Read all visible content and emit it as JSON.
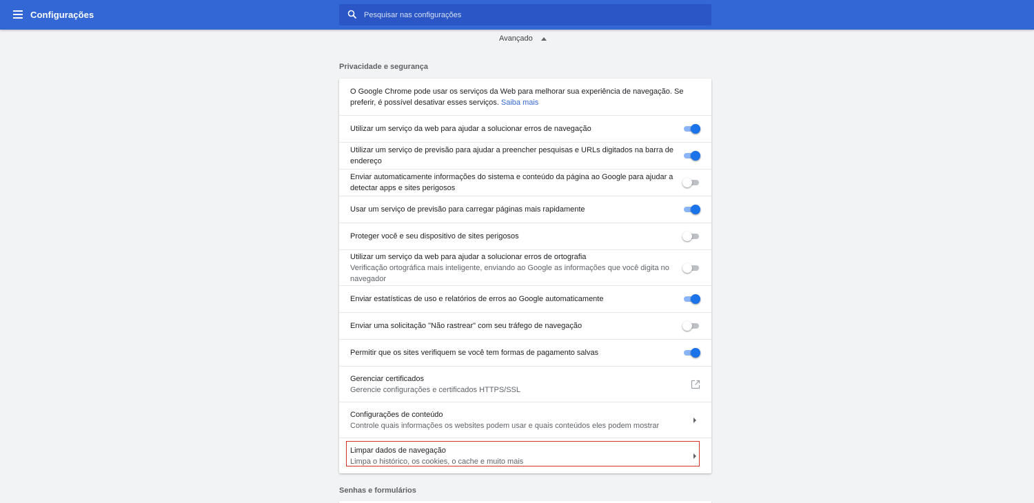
{
  "header": {
    "title": "Configurações",
    "search_placeholder": "Pesquisar nas configurações"
  },
  "advanced_label": "Avançado",
  "privacy": {
    "section_title": "Privacidade e segurança",
    "intro_text": "O Google Chrome pode usar os serviços da Web para melhorar sua experiência de navegação. Se preferir, é possível desativar esses serviços.",
    "intro_link": "Saiba mais",
    "toggles": [
      {
        "label": "Utilizar um serviço da web para ajudar a solucionar erros de navegação",
        "on": true
      },
      {
        "label": "Utilizar um serviço de previsão para ajudar a preencher pesquisas e URLs digitados na barra de endereço",
        "on": true
      },
      {
        "label": "Enviar automaticamente informações do sistema e conteúdo da página ao Google para ajudar a detectar apps e sites perigosos",
        "on": false
      },
      {
        "label": "Usar um serviço de previsão para carregar páginas mais rapidamente",
        "on": true
      },
      {
        "label": "Proteger você e seu dispositivo de sites perigosos",
        "on": false
      },
      {
        "label": "Utilizar um serviço da web para ajudar a solucionar erros de ortografia",
        "sub": "Verificação ortográfica mais inteligente, enviando ao Google as informações que você digita no navegador",
        "on": false
      },
      {
        "label": "Enviar estatísticas de uso e relatórios de erros ao Google automaticamente",
        "on": true
      },
      {
        "label": "Enviar uma solicitação \"Não rastrear\" com seu tráfego de navegação",
        "on": false
      },
      {
        "label": "Permitir que os sites verifiquem se você tem formas de pagamento salvas",
        "on": true
      }
    ],
    "certificates": {
      "label": "Gerenciar certificados",
      "sub": "Gerencie configurações e certificados HTTPS/SSL"
    },
    "content_settings": {
      "label": "Configurações de conteúdo",
      "sub": "Controle quais informações os websites podem usar e quais conteúdos eles podem mostrar"
    },
    "clear_data": {
      "label": "Limpar dados de navegação",
      "sub": "Limpa o histórico, os cookies, o cache e muito mais"
    }
  },
  "passwords": {
    "section_title": "Senhas e formulários"
  },
  "colors": {
    "header": "#3367d6",
    "toggle_on": "#1a73e8",
    "highlight": "#d93025"
  }
}
